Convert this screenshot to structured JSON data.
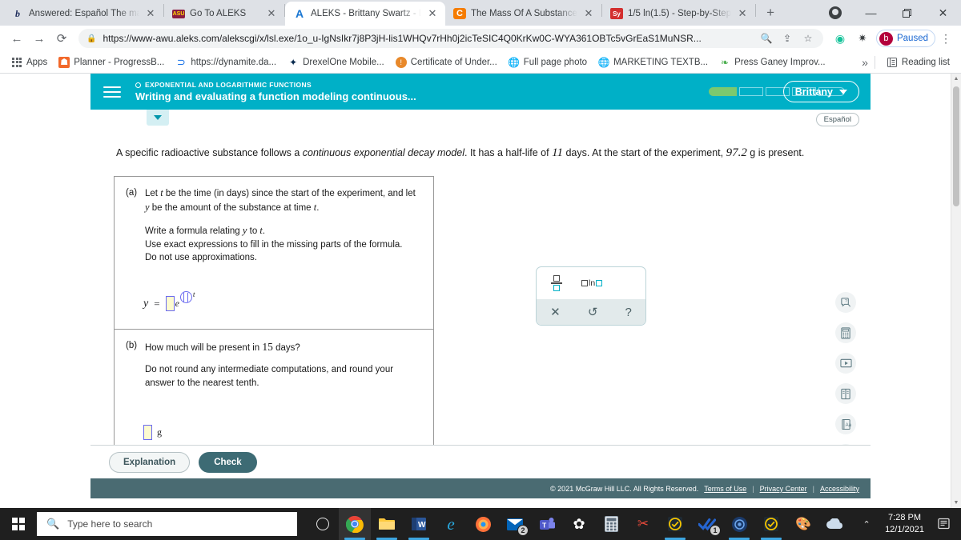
{
  "browser": {
    "tabs": [
      {
        "favicon": "b",
        "favicon_type": "bartleby-b",
        "title": "Answered: Español The ma",
        "active": false
      },
      {
        "favicon": "ASU",
        "favicon_type": "asu-logo",
        "title": "Go To ALEKS",
        "active": false
      },
      {
        "favicon": "A",
        "favicon_type": "aleks-a",
        "title": "ALEKS - Brittany Swartz - L",
        "active": true
      },
      {
        "favicon": "C",
        "favicon_type": "chegg-c",
        "title": "The Mass Of A Substance",
        "active": false
      },
      {
        "favicon": "Sy",
        "favicon_type": "symbolab-sy",
        "title": "1/5 ln(1.5) - Step-by-Step",
        "active": false
      }
    ],
    "new_tab_label": "+",
    "window_controls": {
      "minimize": "—",
      "maximize": "❐",
      "close": "✕"
    },
    "nav": {
      "back": "←",
      "forward": "→",
      "reload": "⟳"
    },
    "omnibox": {
      "lock_icon": "lock-icon",
      "url": "https://www-awu.aleks.com/alekscgi/x/lsl.exe/1o_u-IgNsIkr7j8P3jH-lis1WHQv7rHh0j2icTeSIC4Q0KrKw0C-WYA361OBTc5vGrEaS1MuNSR...",
      "zoom_icon": "search-zoom-icon",
      "share_icon": "share-icon",
      "bookmark_icon": "star-icon"
    },
    "extensions": [
      {
        "name": "grammarly-extension-icon",
        "glyph": "◉"
      },
      {
        "name": "puzzle-extensions-icon",
        "glyph": "🧩"
      }
    ],
    "profile": {
      "avatar_letter": "b",
      "status_label": "Paused"
    },
    "menu_icon": "kebab-menu-icon",
    "bookmarks": [
      {
        "icon": "apps-grid-icon",
        "label": "Apps"
      },
      {
        "icon": "planner-icon",
        "label": "Planner - ProgressB..."
      },
      {
        "icon": "dynamite-icon",
        "label": "https://dynamite.da..."
      },
      {
        "icon": "drexelone-icon",
        "label": "DrexelOne Mobile..."
      },
      {
        "icon": "certificate-icon",
        "label": "Certificate of Under..."
      },
      {
        "icon": "globe-icon",
        "label": "Full page photo"
      },
      {
        "icon": "globe-icon",
        "label": "MARKETING TEXTB..."
      },
      {
        "icon": "press-ganey-icon",
        "label": "Press Ganey Improv..."
      }
    ],
    "bookmarks_overflow": "»",
    "reading_list": {
      "icon": "reading-list-icon",
      "label": "Reading list"
    }
  },
  "aleks": {
    "menu_icon": "hamburger-menu-icon",
    "eyebrow": "EXPONENTIAL AND LOGARITHMIC FUNCTIONS",
    "title": "Writing and evaluating a function modeling continuous...",
    "progress": {
      "segments": 5,
      "filled": 1,
      "fill_color": "#7bc96f"
    },
    "user_button": {
      "label": "Brittany",
      "chevron": "chevron-down-icon"
    },
    "collapse_button": "chevron-down-icon",
    "espanol_button": "Español",
    "problem": {
      "text_part1": "A specific radioactive substance follows a ",
      "text_italic": "continuous exponential decay model",
      "text_part2": ". It has a half-life of ",
      "half_life": "11",
      "text_part3": " days. At the start of the experiment, ",
      "initial_amount": "97.2",
      "text_part4": " g is present."
    },
    "part_a": {
      "label": "(a)",
      "line1_pre": "Let ",
      "line1_var_t": "t",
      "line1_mid": " be the time (in days) since the start of the experiment, and let",
      "line2_var_y": "y",
      "line2_mid": " be the amount of the substance at time ",
      "line2_var_t": "t",
      "line2_end": ".",
      "line3_pre": "Write a formula relating ",
      "line3_var_y": "y",
      "line3_mid": " to ",
      "line3_var_t": "t",
      "line3_end": ".",
      "line4": "Use exact expressions to fill in the missing parts of the formula.",
      "line5": "Do not use approximations.",
      "answer": {
        "y_label": "y",
        "equals": "=",
        "coefficient_value": "",
        "base": "e",
        "exponent_value": "",
        "exponent_var": "t"
      }
    },
    "part_b": {
      "label": "(b)",
      "line1_pre": "How much will be present in ",
      "days": "15",
      "line1_post": " days?",
      "line2": "Do not round any intermediate computations, and round your",
      "line3": "answer to the nearest tenth.",
      "answer": {
        "value": "",
        "unit": "g"
      }
    },
    "keypad": {
      "fraction_button": "fraction-icon",
      "ln_button": "ln-icon",
      "ln_label": "ln",
      "clear_button": "✕",
      "undo_button": "↺",
      "help_button": "?"
    },
    "tool_rail": [
      {
        "name": "explain-help-icon"
      },
      {
        "name": "calculator-icon"
      },
      {
        "name": "video-player-icon"
      },
      {
        "name": "reference-book-icon"
      },
      {
        "name": "text-size-icon"
      },
      {
        "name": "message-envelope-icon"
      }
    ],
    "actions": {
      "explanation_label": "Explanation",
      "check_label": "Check"
    },
    "footer": {
      "copyright": "© 2021 McGraw Hill LLC. All Rights Reserved.",
      "links": [
        "Terms of Use",
        "Privacy Center",
        "Accessibility"
      ],
      "separator": "|"
    }
  },
  "taskbar": {
    "start_icon": "windows-start-icon",
    "search_placeholder": "Type here to search",
    "search_icon": "search-icon",
    "apps": [
      {
        "name": "cortana-icon",
        "glyph": "O",
        "color": "#1f1f1f",
        "running": false
      },
      {
        "name": "chrome-icon",
        "glyph": "",
        "color": "#ffffff",
        "running": true,
        "highlighted": true
      },
      {
        "name": "file-explorer-icon",
        "glyph": "",
        "color": "#ffc83d",
        "running": true
      },
      {
        "name": "word-icon",
        "glyph": "W",
        "color": "#2b579a",
        "running": true
      },
      {
        "name": "edge-icon",
        "glyph": "e",
        "color": "#0f78d4",
        "running": false
      },
      {
        "name": "firefox-icon",
        "glyph": "",
        "color": "#ff7139",
        "running": false
      },
      {
        "name": "mail-icon",
        "glyph": "✉",
        "color": "#0364b8",
        "running": false,
        "badge": "2"
      },
      {
        "name": "teams-icon",
        "glyph": "T",
        "color": "#5059c9",
        "running": false
      },
      {
        "name": "settings-gear-icon",
        "glyph": "✿",
        "color": "#ffffff",
        "running": false
      },
      {
        "name": "calculator-icon",
        "glyph": "▦",
        "color": "#e8e8e8",
        "running": false
      },
      {
        "name": "snipping-tool-icon",
        "glyph": "✂",
        "color": "#e0e0e0",
        "running": false
      },
      {
        "name": "tasks-check-icon",
        "glyph": "✓",
        "color": "#f5c400",
        "running": true
      },
      {
        "name": "todo-checkmark-icon",
        "glyph": "✔",
        "color": "#2564cf",
        "running": false,
        "badge": "1"
      },
      {
        "name": "zoom-meeting-icon",
        "glyph": "◉",
        "color": "#2d8cff",
        "running": true
      },
      {
        "name": "tasks-check-icon-2",
        "glyph": "✓",
        "color": "#f5c400",
        "running": true
      },
      {
        "name": "paint-icon",
        "glyph": "🎨",
        "color": "#e44d26",
        "running": false
      },
      {
        "name": "onedrive-cloud-icon",
        "glyph": "☁",
        "color": "#c7dbf0",
        "running": false
      }
    ],
    "tray": {
      "caret_icon": "show-hidden-icons-chevron",
      "time": "7:28 PM",
      "date": "12/1/2021",
      "notifications_icon": "action-center-icon"
    }
  }
}
